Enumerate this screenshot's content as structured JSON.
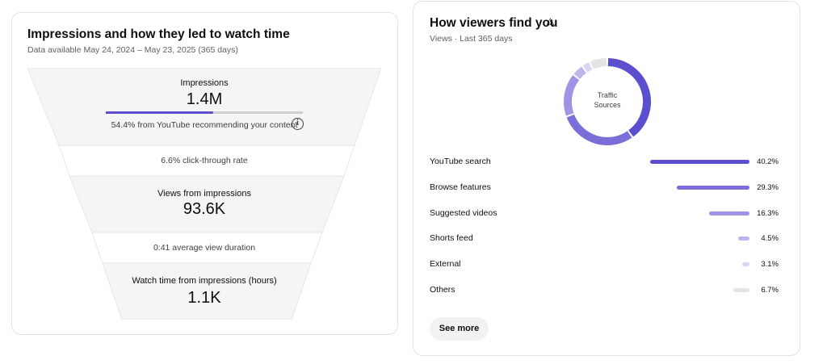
{
  "impressions_card": {
    "title": "Impressions and how they led to watch time",
    "subtitle": "Data available May 24, 2024 – May 23, 2025 (365 days)",
    "impressions_label": "Impressions",
    "impressions_value": "1.4M",
    "recommendation_fraction": 0.544,
    "recommendation_text": "54.4% from YouTube recommending your content",
    "info_icon": "info-icon",
    "ctr_text": "6.6% click-through rate",
    "views_label": "Views from impressions",
    "views_value": "93.6K",
    "avg_duration_text": "0:41 average view duration",
    "watch_label": "Watch time from impressions (hours)",
    "watch_value": "1.1K"
  },
  "traffic_card": {
    "title": "How viewers find you",
    "warning_icon": "warning-icon",
    "subtitle": "Views · Last 365 days",
    "donut_center_line1": "Traffic",
    "donut_center_line2": "Sources",
    "see_more_label": "See more"
  },
  "chart_data": {
    "type": "pie",
    "categories": [
      "YouTube search",
      "Browse features",
      "Suggested videos",
      "Shorts feed",
      "External",
      "Others"
    ],
    "values": [
      40.2,
      29.3,
      16.3,
      4.5,
      3.1,
      6.7
    ],
    "value_labels": [
      "40.2%",
      "29.3%",
      "16.3%",
      "4.5%",
      "3.1%",
      "6.7%"
    ],
    "colors": [
      "#5b4fd0",
      "#7a6ed9",
      "#9d94e3",
      "#bcb6ed",
      "#d9d6f5",
      "#e4e4e4"
    ]
  }
}
